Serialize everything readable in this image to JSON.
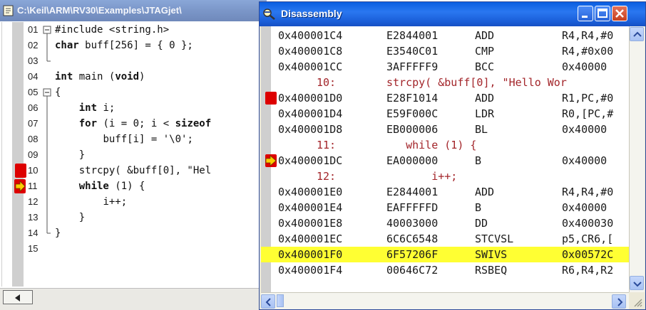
{
  "editor": {
    "title": "C:\\Keil\\ARM\\RV30\\Examples\\JTAGjet\\",
    "lines": [
      {
        "num": "01",
        "code": "#include <string.h>"
      },
      {
        "num": "02",
        "code": [
          "char",
          " buff[256] = { 0 };"
        ]
      },
      {
        "num": "03",
        "code": ""
      },
      {
        "num": "04",
        "code": [
          "int",
          " main (",
          "void",
          ")"
        ]
      },
      {
        "num": "05",
        "code": "{"
      },
      {
        "num": "06",
        "code": [
          "int",
          " i;"
        ]
      },
      {
        "num": "07",
        "code": [
          "for",
          " (i = 0; i < ",
          "sizeof"
        ]
      },
      {
        "num": "08",
        "code": "buff[i] = '\\0';"
      },
      {
        "num": "09",
        "code": "}"
      },
      {
        "num": "10",
        "code": "strcpy( &buff[0], \"Hel"
      },
      {
        "num": "11",
        "code": [
          "while",
          " (1) {"
        ]
      },
      {
        "num": "12",
        "code": "i++;"
      },
      {
        "num": "13",
        "code": "}"
      },
      {
        "num": "14",
        "code": "}"
      },
      {
        "num": "15",
        "code": ""
      }
    ]
  },
  "disassembly": {
    "title": "Disassembly",
    "rows": [
      {
        "kind": "asm",
        "addr": "0x400001C4",
        "opcode": "E2844001",
        "mnemonic": "ADD",
        "args": "R4,R4,#0"
      },
      {
        "kind": "asm",
        "addr": "0x400001C8",
        "opcode": "E3540C01",
        "mnemonic": "CMP",
        "args": "R4,#0x00"
      },
      {
        "kind": "asm",
        "addr": "0x400001CC",
        "opcode": "3AFFFFF9",
        "mnemonic": "BCC",
        "args": "0x40000"
      },
      {
        "kind": "src",
        "lineno": "10:",
        "text": "strcpy( &buff[0], \"Hello Wor"
      },
      {
        "kind": "asm",
        "addr": "0x400001D0",
        "opcode": "E28F1014",
        "mnemonic": "ADD",
        "args": "R1,PC,#0",
        "marker": "breakpoint"
      },
      {
        "kind": "asm",
        "addr": "0x400001D4",
        "opcode": "E59F000C",
        "mnemonic": "LDR",
        "args": "R0,[PC,#"
      },
      {
        "kind": "asm",
        "addr": "0x400001D8",
        "opcode": "EB000006",
        "mnemonic": "BL",
        "args": "0x40000"
      },
      {
        "kind": "src",
        "lineno": "11:",
        "text": "   while (1) {"
      },
      {
        "kind": "asm",
        "addr": "0x400001DC",
        "opcode": "EA000000",
        "mnemonic": "B",
        "args": "0x40000",
        "marker": "current"
      },
      {
        "kind": "src",
        "lineno": "12:",
        "text": "       i++;"
      },
      {
        "kind": "asm",
        "addr": "0x400001E0",
        "opcode": "E2844001",
        "mnemonic": "ADD",
        "args": "R4,R4,#0"
      },
      {
        "kind": "asm",
        "addr": "0x400001E4",
        "opcode": "EAFFFFFD",
        "mnemonic": "B",
        "args": "0x40000"
      },
      {
        "kind": "asm",
        "addr": "0x400001E8",
        "opcode": "40003000",
        "mnemonic": "DD",
        "args": "0x400030"
      },
      {
        "kind": "asm",
        "addr": "0x400001EC",
        "opcode": "6C6C6548",
        "mnemonic": "STCVSL",
        "args": "p5,CR6,["
      },
      {
        "kind": "asm",
        "addr": "0x400001F0",
        "opcode": "6F57206F",
        "mnemonic": "SWIVS",
        "args": "0x00572C",
        "highlight": true
      },
      {
        "kind": "asm",
        "addr": "0x400001F4",
        "opcode": "00646C72",
        "mnemonic": "RSBEQ",
        "args": "R6,R4,R2"
      }
    ]
  },
  "colors": {
    "breakpoint": "#dd0000",
    "current_line_arrow": "#ffcc00",
    "highlight_row": "#ffff33",
    "source_text": "#a3252a",
    "disasm_titlebar": "#2a77f0"
  },
  "icons": {
    "editor_title": "document-icon",
    "disasm_title": "disassembly-icon",
    "minimize": "minimize-icon",
    "maximize": "maximize-icon",
    "close": "close-icon"
  }
}
